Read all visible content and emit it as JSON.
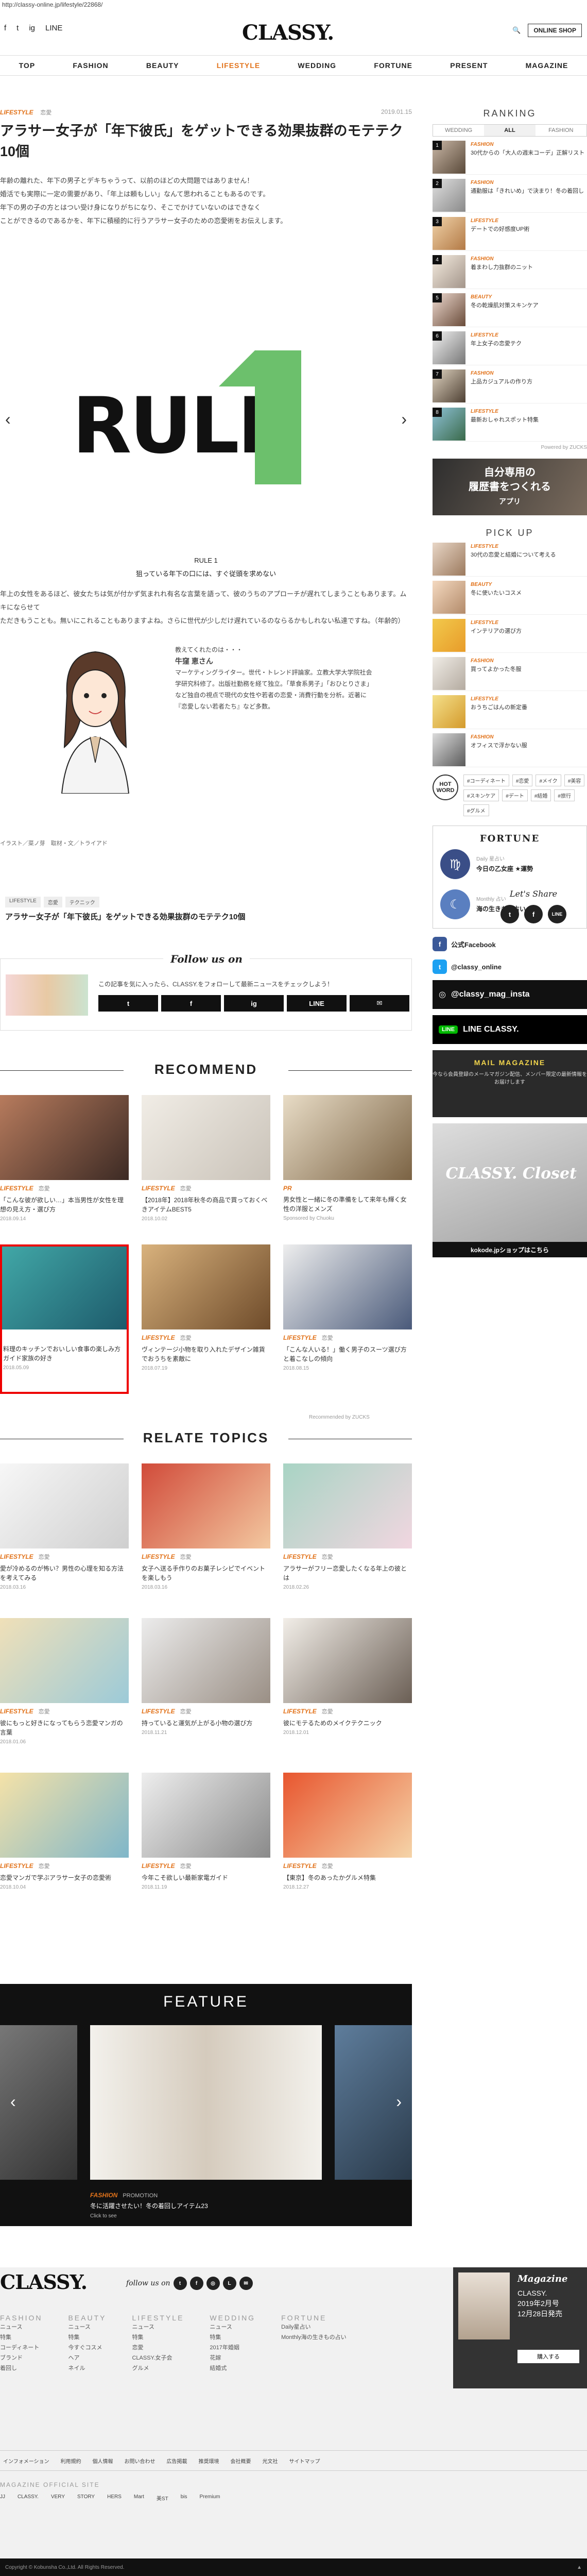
{
  "browser_url": "http://classy-online.jp/lifestyle/22868/",
  "header": {
    "logo": "CLASSY.",
    "social": [
      "f",
      "t",
      "ig",
      "LINE",
      "✉"
    ],
    "online_shop": "ONLINE SHOP",
    "nav": [
      "TOP",
      "FASHION",
      "BEAUTY",
      "LIFESTYLE",
      "WEDDING",
      "FORTUNE",
      "PRESENT",
      "MAGAZINE"
    ],
    "active_nav": "LIFESTYLE"
  },
  "article": {
    "category": "LIFESTYLE",
    "subcategory": "恋愛",
    "date": "2019.01.15",
    "title": "アラサー女子が「年下彼氏」をゲットできる効果抜群のモテテク10個",
    "lead": [
      "年齢の離れた、年下の男子とデキちゃうって、以前のほどの大問題ではありません！",
      "婚活でも実際に一定の需要があり、「年上は頼もしい」なんて思われることもあるのです。",
      "年下の男の子の方とはつい受け身になりがちになり、そこでかけていないのはできなく",
      "ことができるのであるかを、年下に積極的に行うアラサー女子のための恋愛術をお伝えします。"
    ],
    "slide": {
      "word": "RULE",
      "number": "1"
    },
    "rule_label": "RULE 1",
    "rule_title": "狙っている年下の口には、すぐ従頭を求めない",
    "body": [
      "年上の女性をあるほど、彼女たちは気が付かず気まれれ有名な言葉を語って、彼のうちのアプローチが遅れてしまうこともあります。ムキにならせて",
      "ただきもうことも。無いにこれることもありますよね。さらに世代が少しだけ遅れているのならるかもしれない私達ですね。（年齢的）"
    ],
    "profile": {
      "heading": "教えてくれたのは・・・",
      "name": "牛窪 恵さん",
      "text": "マーケティングライター。世代・トレンド評論家。立教大学大学院社会学研究科修了。出版社勤務を経て独立。「草食系男子」「おひとりさま」など独自の視点で現代の女性や若者の恋愛・消費行動を分析。近著に『恋愛しない若者たち』など多数。"
    },
    "credit": "イラスト／菜ノ芽　取材・文／トライアド",
    "tags": [
      "LIFESTYLE",
      "恋愛",
      "テクニック"
    ],
    "title_again": "アラサー女子が「年下彼氏」をゲットできる効果抜群のモテテク10個",
    "share_heading": "Let's Share",
    "share_icons": [
      "t",
      "f",
      "LINE"
    ]
  },
  "follow": {
    "heading": "Follow us on",
    "text": "この記事を気に入ったら、CLASSY.をフォローして最新ニュースをチェックしよう！",
    "buttons": [
      "t",
      "f",
      "ig",
      "LINE",
      "✉"
    ]
  },
  "recommend": {
    "heading": "RECOMMEND",
    "items": [
      {
        "cat": "LIFESTYLE",
        "sub": "恋愛",
        "title": "「こんな彼が欲しい…」本当男性が女性を理想の見え方・選び方",
        "date": "2018.09.14"
      },
      {
        "cat": "LIFESTYLE",
        "sub": "恋愛",
        "title": "【2018年】2018年秋冬の商品で買っておくべきアイテムBEST5",
        "date": "2018.10.02"
      },
      {
        "cat": "PR",
        "sub": "",
        "title": "男女性と一緒に冬の準備をして来年も輝く女性の洋服とメンズ",
        "date": "Sponsored by Chuoku"
      },
      {
        "cat": "",
        "sub": "",
        "title": "料理のキッチンでおいしい食事の楽しみ方ガイド家族の好き",
        "date": "2018.05.09"
      },
      {
        "cat": "LIFESTYLE",
        "sub": "恋愛",
        "title": "ヴィンテージ小物を取り入れたデザイン雑貨でおうちを素敵に",
        "date": "2018.07.19"
      },
      {
        "cat": "LIFESTYLE",
        "sub": "恋愛",
        "title": "「こんな人いる！」働く男子のスーツ選び方と着こなしの傾向",
        "date": "2018.08.15"
      }
    ],
    "provided_by": "Recommended by ZUCKS"
  },
  "related": {
    "heading": "RELATE TOPICS",
    "items": [
      {
        "cat": "LIFESTYLE",
        "sub": "恋愛",
        "title": "愛が冷めるのが怖い？男性の心理を知る方法を考えてみる",
        "date": "2018.03.16"
      },
      {
        "cat": "LIFESTYLE",
        "sub": "恋愛",
        "title": "女子へ送る手作りのお菓子レシピでイベントを楽しもう",
        "date": "2018.03.16"
      },
      {
        "cat": "LIFESTYLE",
        "sub": "恋愛",
        "title": "アラサーがフリー恋愛したくなる年上の彼とは",
        "date": "2018.02.26"
      },
      {
        "cat": "LIFESTYLE",
        "sub": "恋愛",
        "title": "彼にもっと好きになってもらう恋愛マンガの言葉",
        "date": "2018.01.06"
      },
      {
        "cat": "LIFESTYLE",
        "sub": "恋愛",
        "title": "持っていると運気が上がる小物の選び方",
        "date": "2018.11.21"
      },
      {
        "cat": "LIFESTYLE",
        "sub": "恋愛",
        "title": "彼にモテるためのメイクテクニック",
        "date": "2018.12.01"
      },
      {
        "cat": "LIFESTYLE",
        "sub": "恋愛",
        "title": "恋愛マンガで学ぶアラサー女子の恋愛術",
        "date": "2018.10.04"
      },
      {
        "cat": "LIFESTYLE",
        "sub": "恋愛",
        "title": "今年こそ欲しい最新家電ガイド",
        "date": "2018.11.19"
      },
      {
        "cat": "LIFESTYLE",
        "sub": "恋愛",
        "title": "【東京】冬のあったかグルメ特集",
        "date": "2018.12.27"
      }
    ]
  },
  "feature": {
    "heading": "FEATURE",
    "cat": "FASHION",
    "sub": "PROMOTION",
    "caption": "冬に活躍させたい！冬の着回しアイテム23",
    "more": "Click to see"
  },
  "sidebar": {
    "ranking_heading": "RANKING",
    "tabs": [
      "WEDDING",
      "ALL",
      "FASHION"
    ],
    "active_tab": "ALL",
    "ranking": [
      {
        "rank": "1",
        "cat": "FASHION",
        "title": "30代からの「大人の週末コーデ」正解リスト"
      },
      {
        "rank": "2",
        "cat": "FASHION",
        "title": "通勤服は「きれいめ」で決まり！冬の着回し"
      },
      {
        "rank": "3",
        "cat": "LIFESTYLE",
        "title": "デートでの好感度UP術"
      },
      {
        "rank": "4",
        "cat": "FASHION",
        "title": "着まわし力抜群のニット"
      },
      {
        "rank": "5",
        "cat": "BEAUTY",
        "title": "冬の乾燥肌対策スキンケア"
      },
      {
        "rank": "6",
        "cat": "LIFESTYLE",
        "title": "年上女子の恋愛テク"
      },
      {
        "rank": "7",
        "cat": "FASHION",
        "title": "上品カジュアルの作り方"
      },
      {
        "rank": "8",
        "cat": "LIFESTYLE",
        "title": "最新おしゃれスポット特集"
      }
    ],
    "ranking_provided": "Powered by ZUCKS",
    "banner_text": [
      "自分専用の",
      "履歴書をつくれる",
      "アプリ"
    ],
    "pickup_heading": "PICK UP",
    "pickup": [
      {
        "cat": "LIFESTYLE",
        "title": "30代の恋愛と結婚について考える"
      },
      {
        "cat": "BEAUTY",
        "title": "冬に使いたいコスメ"
      },
      {
        "cat": "LIFESTYLE",
        "title": "インテリアの選び方"
      },
      {
        "cat": "FASHION",
        "title": "買ってよかった冬服"
      },
      {
        "cat": "LIFESTYLE",
        "title": "おうちごはんの新定番"
      },
      {
        "cat": "FASHION",
        "title": "オフィスで浮かない服"
      }
    ],
    "hot_word_label": "HOT WORD",
    "hot_words": [
      "#コーディネート",
      "#恋愛",
      "#メイク",
      "#美容",
      "#スキンケア",
      "#デート",
      "#結婚",
      "#旅行",
      "#グルメ"
    ],
    "fortune_heading": "FORTUNE",
    "fortune": [
      {
        "icon": "♍",
        "label": "Daily 星占い",
        "text": "今日の乙女座 ★運勢"
      },
      {
        "icon": "☾",
        "label": "Monthly 占い",
        "text": "海の生きもの占い"
      }
    ],
    "sns": [
      {
        "icon": "f",
        "color": "#3b5998",
        "label": "公式Facebook"
      },
      {
        "icon": "t",
        "color": "#1da1f2",
        "label": "@classy_online"
      }
    ],
    "instagram": "@classy_mag_insta",
    "line": "LINE CLASSY.",
    "mail_heading": "MAIL MAGAZINE",
    "mail_text": "今なら会員登録のメールマガジン配信、メンバー限定の最新情報をお届けします",
    "closet_logo": "CLASSY. Closet",
    "closet_label": "kokode.jpショップはこちら"
  },
  "footer": {
    "logo": "CLASSY.",
    "follow": "follow us on",
    "cols": [
      {
        "h": "FASHION",
        "items": [
          "ニュース",
          "特集",
          "コーディネート",
          "ブランド",
          "着回し"
        ]
      },
      {
        "h": "BEAUTY",
        "items": [
          "ニュース",
          "特集",
          "今すぐコスメ",
          "ヘア",
          "ネイル"
        ]
      },
      {
        "h": "LIFESTYLE",
        "items": [
          "ニュース",
          "特集",
          "恋愛",
          "CLASSY.女子会",
          "グルメ"
        ]
      },
      {
        "h": "WEDDING",
        "items": [
          "ニュース",
          "特集",
          "2017年婚姻",
          "花嫁",
          "結婚式"
        ]
      },
      {
        "h": "FORTUNE",
        "items": [
          "Daily星占い",
          "Monthly海の生きもの占い"
        ]
      }
    ],
    "magazine_title": "Magazine",
    "magazine_sub": [
      "CLASSY.",
      "2019年2月号",
      "12月28日発売"
    ],
    "magazine_btn": "購入する",
    "links": [
      "インフォメーション",
      "利用規約",
      "個人情報",
      "お問い合わせ",
      "広告掲載",
      "推奨環境",
      "会社概要",
      "光文社",
      "サイトマップ"
    ],
    "sites_heading": "MAGAZINE OFFICIAL SITE",
    "sites": [
      "JJ",
      "CLASSY.",
      "VERY",
      "STORY",
      "HERS",
      "Mart",
      "美ST",
      "bis",
      "Premium"
    ],
    "copyright": "Copyright © Kobunsha Co.,Ltd. All Rights Reserved."
  }
}
